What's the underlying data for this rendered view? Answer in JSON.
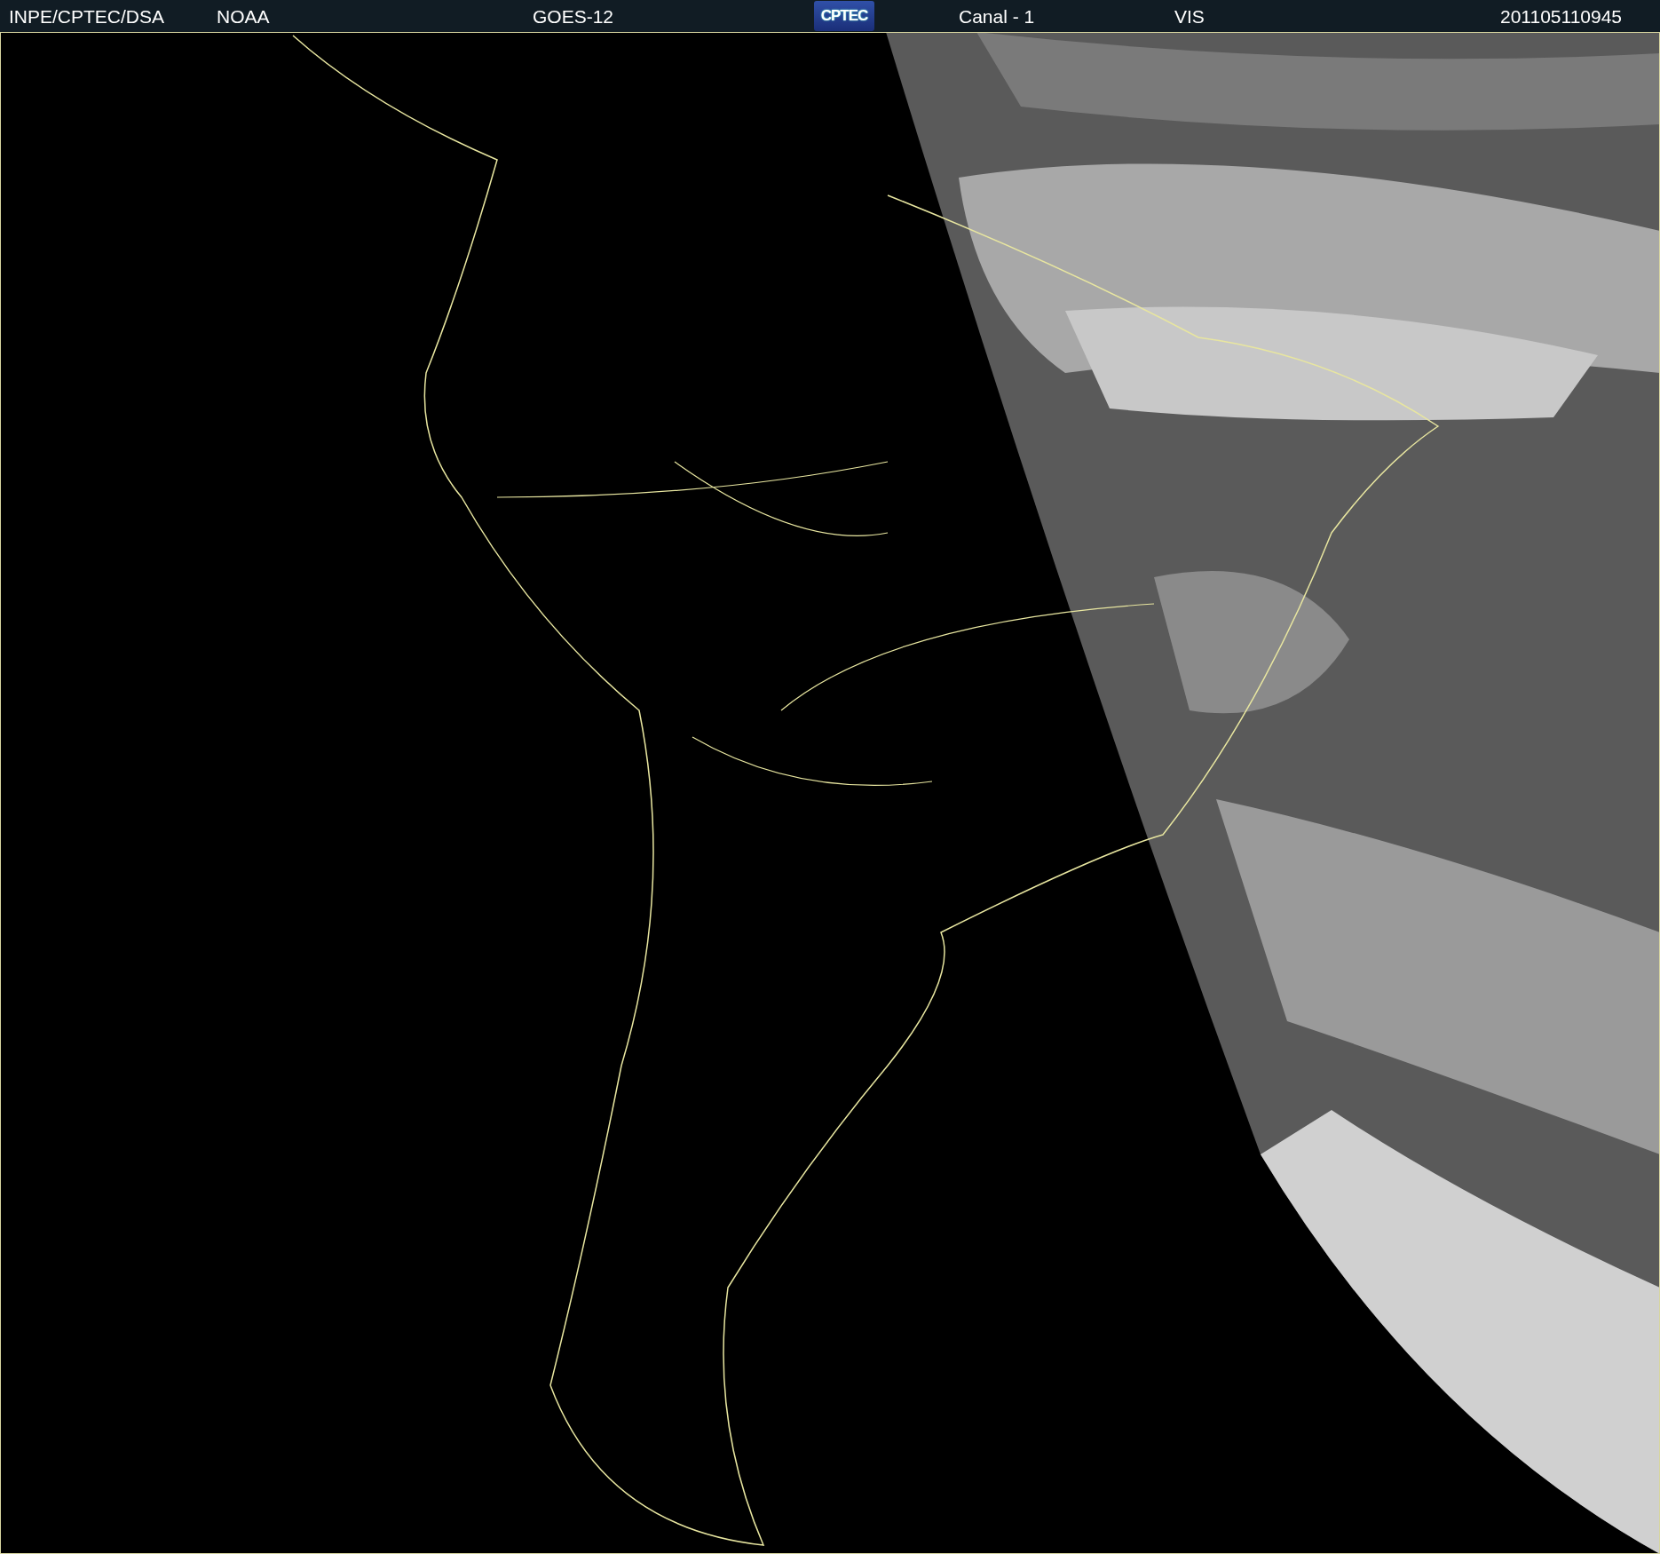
{
  "header": {
    "items": [
      {
        "kind": "text",
        "text": "INPE/CPTEC/DSA"
      },
      {
        "kind": "text",
        "text": "NOAA"
      },
      {
        "kind": "text",
        "text": "GOES-12"
      },
      {
        "kind": "logo",
        "text": "CPTEC"
      },
      {
        "kind": "text",
        "text": "Canal - 1"
      },
      {
        "kind": "text",
        "text": "VIS"
      },
      {
        "kind": "text",
        "text": "201105110945"
      }
    ]
  }
}
